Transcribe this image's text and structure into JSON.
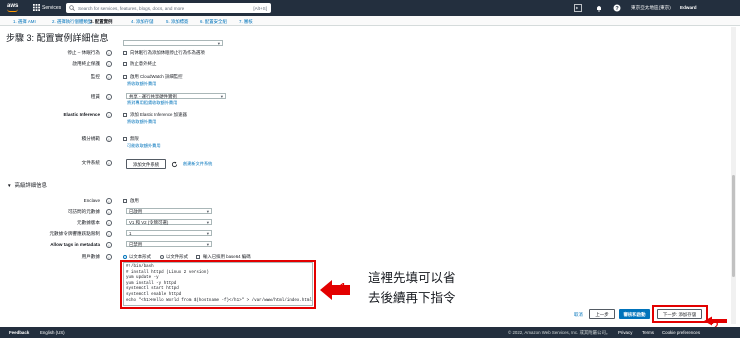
{
  "topbar": {
    "logo": "aws",
    "services_label": "Services",
    "search_placeholder": "Search for services, features, blogs, docs, and more",
    "search_shortcut": "[Alt+S]",
    "region": "東京亞太地區(東京)",
    "user": "Edward"
  },
  "steps": [
    "1. 選擇 AMI",
    "2. 選擇執行個體類型",
    "3. 配置實例",
    "4. 添加存儲",
    "5. 添加標簽",
    "6. 配置安全組",
    "7. 審核"
  ],
  "page_title": "步驟 3: 配置實例詳細信息",
  "fields": {
    "shutdown_behavior": "停止 – 休眠行為",
    "shutdown_check": "向休眠行為添加休眠停止行為作為選項",
    "termination_protection": "啟用終止保護",
    "termination_check": "防止意外終止",
    "monitoring": "監控",
    "monitoring_check": "啟用 CloudWatch 詳細監控",
    "monitoring_link": "將收取額外費用",
    "tenancy": "租賃",
    "tenancy_value": "共享 - 運行共享硬件實例",
    "tenancy_link": "將對專用租賃收取額外費用",
    "elastic_inference": "Elastic Inference",
    "ei_check": "添加 Elastic Inference 加速器",
    "ei_link": "將收取額外費用",
    "credit": "積分規範",
    "credit_check": "無限",
    "credit_link": "可能收取額外費用",
    "file_system": "文件系統",
    "add_fs_button": "添加文件系統",
    "create_fs_link": "創建新文件系統"
  },
  "advanced": {
    "section_title": "高級詳細信息",
    "enclave": "Enclave",
    "enclave_check": "啟用",
    "metadata_access": "可訪問的元數據",
    "metadata_access_value": "已啟用",
    "metadata_version": "元數據版本",
    "metadata_version_value": "V1 和 V2 (令牌可選)",
    "hop_limit": "元數據令牌響應跃點限制",
    "hop_limit_value": "1",
    "allow_tags": "Allow tags in metadata",
    "allow_tags_value": "已禁用",
    "user_data": "用戶數據",
    "radio_text": "以文本形式",
    "radio_file": "以文件形式",
    "base64_check": "輸入已採用 base64 編碼",
    "user_data_content": "#!/bin/bash\n# install httpd (Linux 2 version)\nyum update -y\nyum install -y httpd\nsystemctl start httpd\nsystemctl enable httpd\necho \"<h1>Hello World from $(hostname -f)</h1>\" > /var/www/html/index.html"
  },
  "annotation": {
    "num1": "1",
    "line1": "這裡先填可以省",
    "line2": "去後續再下指令",
    "num2": "2"
  },
  "actions": {
    "cancel": "取消",
    "previous": "上一步",
    "review_launch": "審核和啟動",
    "next": "下一步: 添加存儲"
  },
  "footer": {
    "feedback": "Feedback",
    "language": "English (US)",
    "copyright": "© 2022, Amazon Web Services, Inc. 或其附屬公司。",
    "privacy": "Privacy",
    "terms": "Terms",
    "cookies": "Cookie preferences"
  },
  "colors": {
    "topbar": "#232f3e",
    "link": "#0073bb",
    "annotation_red": "#e30000",
    "primary_button": "#0073bb"
  }
}
